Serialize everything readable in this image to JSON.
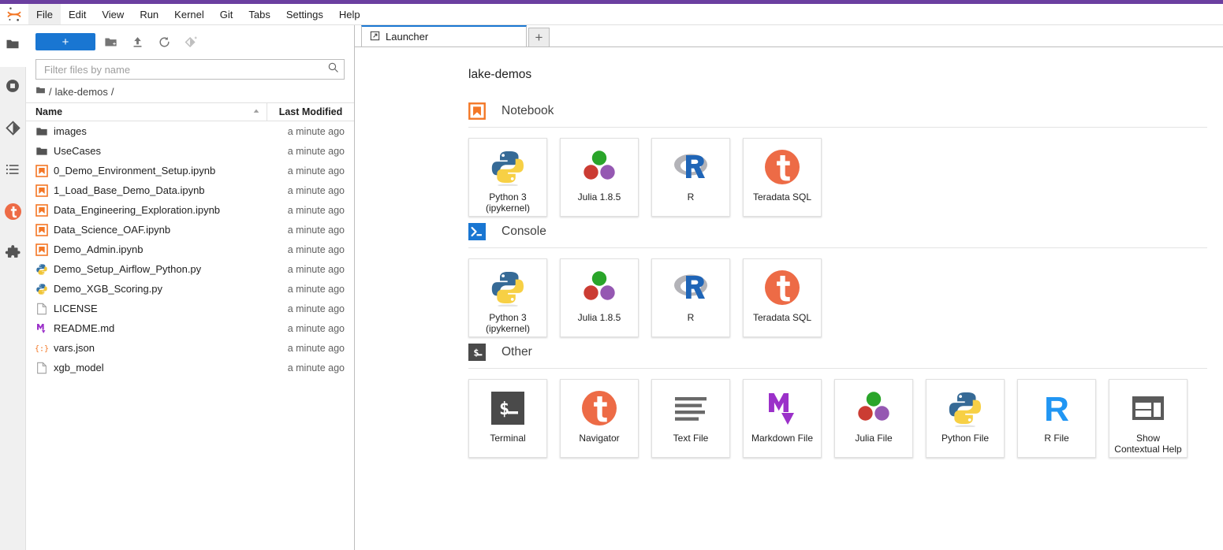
{
  "app": {
    "logo_icon": "jupyter-logo",
    "top_accent_color": "#6b3fa0",
    "accent_blue": "#1976d2",
    "accent_orange": "#ed6b46"
  },
  "menubar": {
    "items": [
      {
        "label": "File",
        "active": true
      },
      {
        "label": "Edit",
        "active": false
      },
      {
        "label": "View",
        "active": false
      },
      {
        "label": "Run",
        "active": false
      },
      {
        "label": "Kernel",
        "active": false
      },
      {
        "label": "Git",
        "active": false
      },
      {
        "label": "Tabs",
        "active": false
      },
      {
        "label": "Settings",
        "active": false
      },
      {
        "label": "Help",
        "active": false
      }
    ]
  },
  "rail": {
    "items": [
      {
        "name": "file-browser",
        "icon": "folder-icon",
        "selected": true
      },
      {
        "name": "running-terminals",
        "icon": "stop-circle-icon",
        "selected": false
      },
      {
        "name": "git-panel",
        "icon": "git-diamond-icon",
        "selected": false
      },
      {
        "name": "table-of-contents",
        "icon": "list-icon",
        "selected": false
      },
      {
        "name": "teradata-panel",
        "icon": "teradata-t-icon",
        "selected": false
      },
      {
        "name": "extension-manager",
        "icon": "puzzle-icon",
        "selected": false
      }
    ]
  },
  "filebrowser": {
    "new_launcher_label": "+",
    "toolbar_icons": [
      {
        "name": "new-folder-icon",
        "title": "New Folder"
      },
      {
        "name": "upload-icon",
        "title": "Upload Files"
      },
      {
        "name": "refresh-icon",
        "title": "Refresh File List"
      },
      {
        "name": "git-clone-icon",
        "title": "Git Clone"
      }
    ],
    "filter_placeholder": "Filter files by name",
    "filter_value": "",
    "search_icon": "search-icon",
    "breadcrumb": {
      "home_icon": "folder-icon",
      "separator": "/",
      "path": "lake-demos",
      "trailing": "/"
    },
    "columns": {
      "name": "Name",
      "last_modified": "Last Modified",
      "sort_indicator": "ascending"
    },
    "rows": [
      {
        "name": "images",
        "modified": "a minute ago",
        "icon": "folder-icon"
      },
      {
        "name": "UseCases",
        "modified": "a minute ago",
        "icon": "folder-icon"
      },
      {
        "name": "0_Demo_Environment_Setup.ipynb",
        "modified": "a minute ago",
        "icon": "notebook-icon"
      },
      {
        "name": "1_Load_Base_Demo_Data.ipynb",
        "modified": "a minute ago",
        "icon": "notebook-icon"
      },
      {
        "name": "Data_Engineering_Exploration.ipynb",
        "modified": "a minute ago",
        "icon": "notebook-icon"
      },
      {
        "name": "Data_Science_OAF.ipynb",
        "modified": "a minute ago",
        "icon": "notebook-icon"
      },
      {
        "name": "Demo_Admin.ipynb",
        "modified": "a minute ago",
        "icon": "notebook-icon"
      },
      {
        "name": "Demo_Setup_Airflow_Python.py",
        "modified": "a minute ago",
        "icon": "python-file-icon"
      },
      {
        "name": "Demo_XGB_Scoring.py",
        "modified": "a minute ago",
        "icon": "python-file-icon"
      },
      {
        "name": "LICENSE",
        "modified": "a minute ago",
        "icon": "generic-file-icon"
      },
      {
        "name": "README.md",
        "modified": "a minute ago",
        "icon": "markdown-file-icon"
      },
      {
        "name": "vars.json",
        "modified": "a minute ago",
        "icon": "json-file-icon"
      },
      {
        "name": "xgb_model",
        "modified": "a minute ago",
        "icon": "generic-file-icon"
      }
    ]
  },
  "tabbar": {
    "tabs": [
      {
        "label": "Launcher",
        "icon": "launcher-icon",
        "active": true
      }
    ],
    "add_tab_label": "+"
  },
  "launcher": {
    "folder_title": "lake-demos",
    "sections": [
      {
        "label": "Notebook",
        "icon": "notebook-section-icon",
        "cards": [
          {
            "label": "Python 3\n(ipykernel)",
            "icon": "python-logo-icon"
          },
          {
            "label": "Julia 1.8.5",
            "icon": "julia-logo-icon"
          },
          {
            "label": "R",
            "icon": "r-logo-icon"
          },
          {
            "label": "Teradata SQL",
            "icon": "teradata-t-icon"
          }
        ]
      },
      {
        "label": "Console",
        "icon": "console-section-icon",
        "cards": [
          {
            "label": "Python 3\n(ipykernel)",
            "icon": "python-logo-icon"
          },
          {
            "label": "Julia 1.8.5",
            "icon": "julia-logo-icon"
          },
          {
            "label": "R",
            "icon": "r-logo-icon"
          },
          {
            "label": "Teradata SQL",
            "icon": "teradata-t-icon"
          }
        ]
      },
      {
        "label": "Other",
        "icon": "other-section-icon",
        "cards": [
          {
            "label": "Terminal",
            "icon": "terminal-icon"
          },
          {
            "label": "Navigator",
            "icon": "teradata-t-icon"
          },
          {
            "label": "Text File",
            "icon": "text-file-icon"
          },
          {
            "label": "Markdown File",
            "icon": "markdown-file-icon"
          },
          {
            "label": "Julia File",
            "icon": "julia-logo-icon"
          },
          {
            "label": "Python File",
            "icon": "python-logo-icon"
          },
          {
            "label": "R File",
            "icon": "r-letter-icon"
          },
          {
            "label": "Show\nContextual Help",
            "icon": "contextual-help-icon"
          }
        ]
      }
    ]
  }
}
